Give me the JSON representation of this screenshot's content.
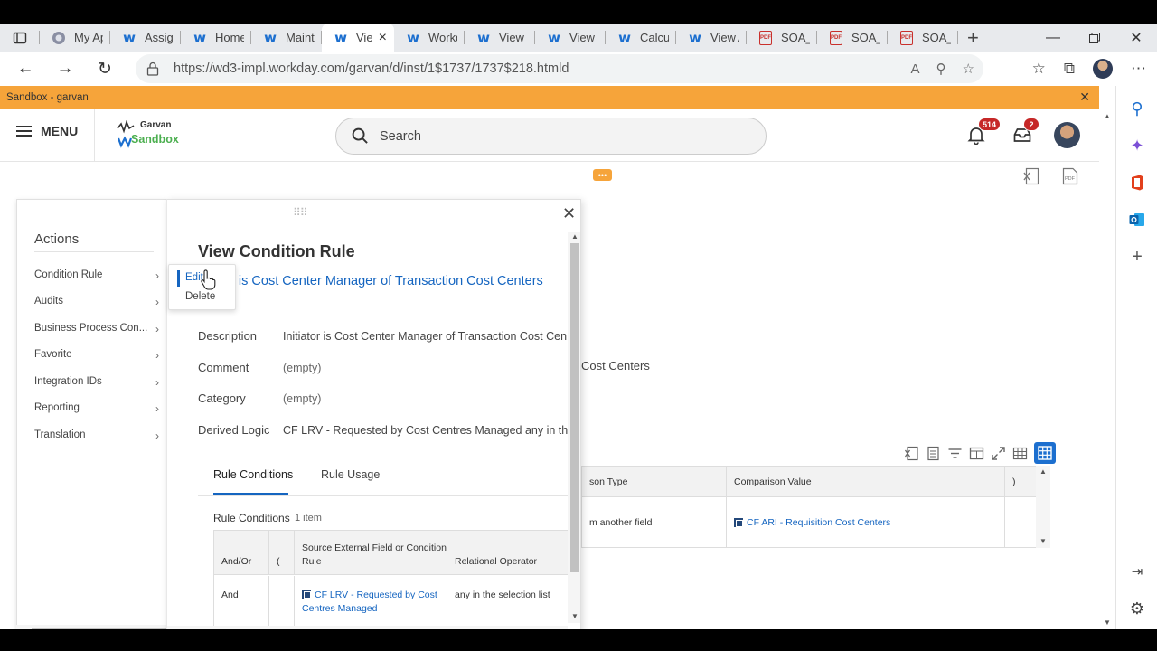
{
  "browser": {
    "tabs": [
      {
        "label": "My App",
        "icon": "chrome-icon"
      },
      {
        "label": "Assign I",
        "icon": "workday-icon"
      },
      {
        "label": "Home -",
        "icon": "workday-icon"
      },
      {
        "label": "Maintai",
        "icon": "workday-icon"
      },
      {
        "label": "Vie",
        "icon": "workday-icon",
        "active": true
      },
      {
        "label": "Workda",
        "icon": "workday-icon"
      },
      {
        "label": "View Co",
        "icon": "workday-icon"
      },
      {
        "label": "View Co",
        "icon": "workday-icon"
      },
      {
        "label": "Calculat",
        "icon": "workday-icon"
      },
      {
        "label": "View As",
        "icon": "workday-icon"
      },
      {
        "label": "SOA_In",
        "icon": "pdf-icon"
      },
      {
        "label": "SOA_In",
        "icon": "pdf-icon"
      },
      {
        "label": "SOA_In",
        "icon": "pdf-icon"
      }
    ],
    "url": "https://wd3-impl.workday.com/garvan/d/inst/1$1737/1737$218.htmld",
    "pdf_label": "PDF"
  },
  "sandbox_bar": {
    "text": "Sandbox - garvan"
  },
  "header": {
    "menu_label": "MENU",
    "logo_top": "Garvan",
    "logo_bottom": "Sandbox",
    "search_placeholder": "Search",
    "notifications_count": "514",
    "inbox_count": "2"
  },
  "background": {
    "partial_text": "Cost Centers",
    "table": {
      "headers": [
        "son Type",
        "Comparison Value",
        ")"
      ],
      "row": {
        "col1": "m another field",
        "col2": "CF ARI - Requisition Cost Centers",
        "col3": ""
      }
    },
    "export_pdf_label": "PDF"
  },
  "actions": {
    "title": "Actions",
    "items": [
      {
        "label": "Condition Rule"
      },
      {
        "label": "Audits"
      },
      {
        "label": "Business Process Con..."
      },
      {
        "label": "Favorite"
      },
      {
        "label": "Integration IDs"
      },
      {
        "label": "Reporting"
      },
      {
        "label": "Translation"
      }
    ]
  },
  "flyout": {
    "edit": "Edit",
    "delete": "Delete"
  },
  "popup": {
    "title": "View Condition Rule",
    "subtitle": "or is Cost Center Manager of Transaction Cost Centers",
    "fields": [
      {
        "label": "Description",
        "value": "Initiator is Cost Center Manager of Transaction Cost Cen"
      },
      {
        "label": "Comment",
        "value": "(empty)"
      },
      {
        "label": "Category",
        "value": "(empty)"
      },
      {
        "label": "Derived Logic",
        "value": "CF LRV - Requested by Cost Centres Managed any in the"
      }
    ],
    "tabs": [
      "Rule Conditions",
      "Rule Usage"
    ],
    "rule_conditions_label": "Rule Conditions",
    "rule_conditions_count": "1 item",
    "table": {
      "headers": [
        "And/Or",
        "(",
        "Source External Field or Condition Rule",
        "Relational Operator"
      ],
      "row": {
        "and_or": "And",
        "paren": "",
        "source": "CF LRV - Requested by Cost Centres Managed",
        "operator": "any in the selection list"
      }
    }
  }
}
